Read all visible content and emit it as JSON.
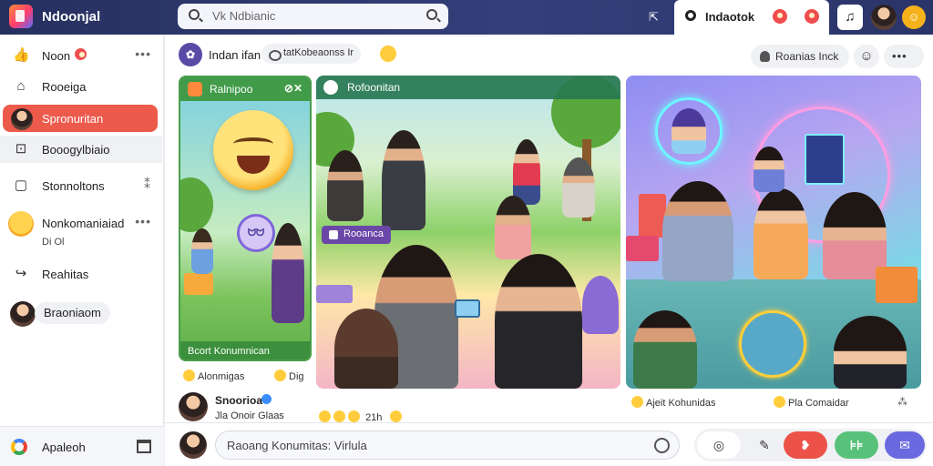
{
  "topbar": {
    "app_title": "Ndoonjal",
    "search_placeholder": "Vk Ndbianic",
    "active_tab_label": "Indaotok",
    "music_button": "♫",
    "coin_label": "☺"
  },
  "sidebar": {
    "items": [
      {
        "label": "Noon",
        "icon": "thumbs-up-icon",
        "badge": true,
        "more": "•••"
      },
      {
        "label": "Rooeiga",
        "icon": "home-icon"
      },
      {
        "label": "Spronuritan",
        "icon": "avatar",
        "active": true
      },
      {
        "label": "Booogylbiaio",
        "icon": "image-icon"
      },
      {
        "label": "Stonnoltons",
        "icon": "bookmark-icon",
        "more": "⁑"
      },
      {
        "label": "Nonkomaniaiad",
        "icon": "smiley-icon",
        "more": "•••",
        "sub": "Di Ol"
      },
      {
        "label": "Reahitas",
        "icon": "share-icon"
      },
      {
        "label": "Braoniaom",
        "icon": "avatar"
      }
    ],
    "footer_label": "Apaleoh",
    "colors": {
      "active": "#ec5a4c"
    }
  },
  "main": {
    "header": {
      "title": "Indan ifan",
      "chip": "tatKobeaonss Ir",
      "button_a": "Roanias Inck",
      "button_b": "☺",
      "button_c": "•••"
    },
    "cards": [
      {
        "bar_label": "Ralnipoo",
        "bar_action": "⊘✕",
        "caption": "Bcort Konumnican",
        "bubble": "ᗢᗢ"
      },
      {
        "bar_label": "Rofoonitan",
        "tag": "Rooanca"
      },
      {}
    ],
    "card_captions": {
      "card1_left": "Alonmigas",
      "card1_right": "Dig",
      "card3_left": "Ajeit Kohunidas",
      "card3_right": "Pla Comaidar"
    },
    "post": {
      "name": "Snoorioa",
      "sub": "Jla Onoir Glaas",
      "emojis": "21h"
    },
    "composer": {
      "placeholder": "Raoang Konumitas: Virlula",
      "tool_cam": "◎",
      "tool_pen": "✎",
      "tool_red": "❥",
      "tool_green": "⊧⊧",
      "tool_purple": "✉"
    }
  }
}
